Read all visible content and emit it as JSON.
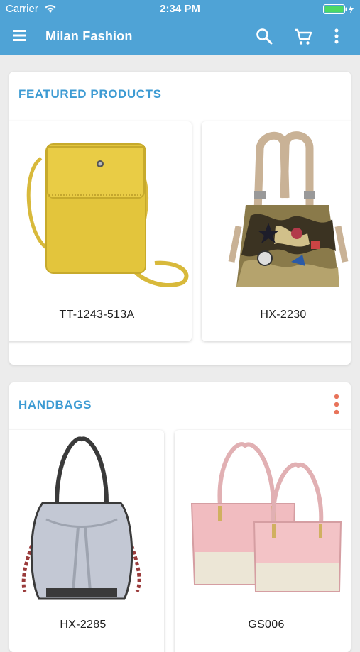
{
  "status_bar": {
    "carrier": "Carrier",
    "time": "2:34 PM"
  },
  "app_bar": {
    "title": "Milan Fashion",
    "icons": [
      "menu-icon",
      "search-icon",
      "cart-icon",
      "more-vertical-icon"
    ]
  },
  "colors": {
    "primary": "#4fa3d6",
    "section_title": "#3d9bd3",
    "kebab_accent": "#e8735a",
    "background": "#ececec"
  },
  "featured": {
    "title": "FEATURED PRODUCTS",
    "products": [
      {
        "code": "TT-1243-513A"
      },
      {
        "code": "HX-2230"
      }
    ]
  },
  "handbags": {
    "title": "HANDBAGS",
    "products": [
      {
        "code": "HX-2285"
      },
      {
        "code": "GS006"
      }
    ]
  }
}
